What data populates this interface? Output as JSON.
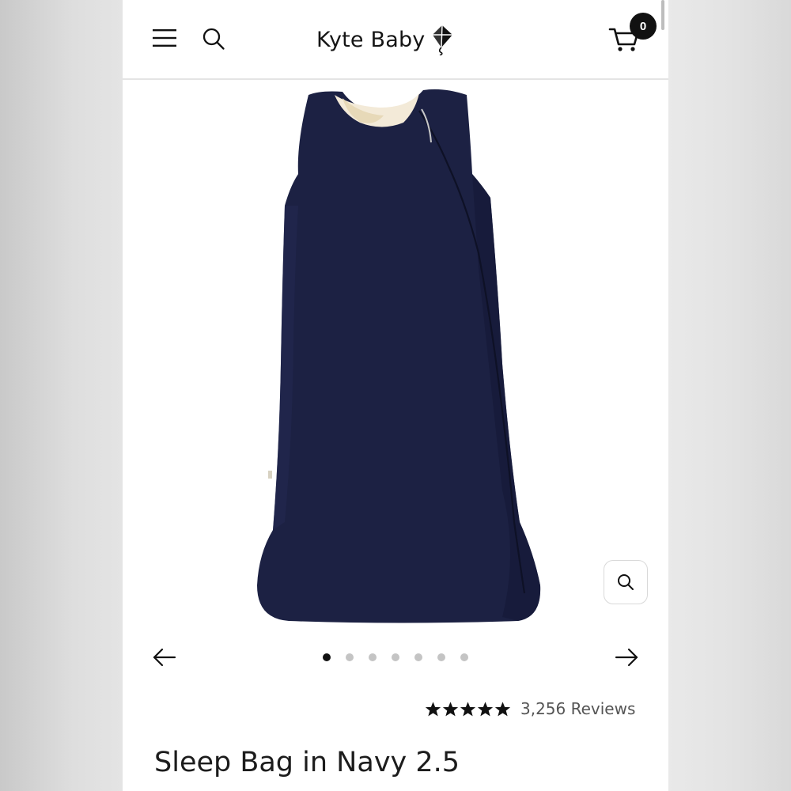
{
  "header": {
    "brand": "Kyte Baby",
    "cart_count": "0",
    "icons": [
      "hamburger-menu-icon",
      "search-icon",
      "kite-logo-icon",
      "cart-icon"
    ]
  },
  "gallery": {
    "image_alt": "Sleep Bag in Navy 2.5",
    "slide_count": 7,
    "active_slide": 1,
    "icons": [
      "zoom-icon",
      "arrow-left-icon",
      "arrow-right-icon"
    ]
  },
  "product": {
    "rating": 5,
    "reviews_label": "3,256 Reviews",
    "title": "Sleep Bag in Navy 2.5"
  },
  "colors": {
    "navy": "#1c2143",
    "text": "#1c1c1c",
    "muted": "#555555"
  }
}
